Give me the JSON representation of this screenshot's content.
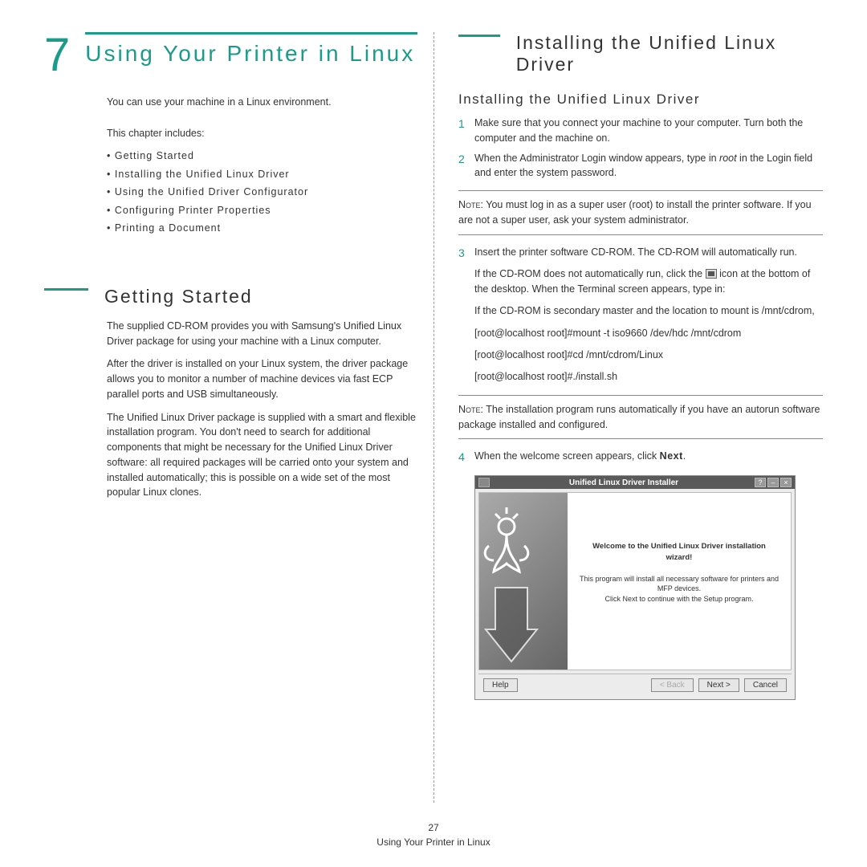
{
  "chapter": {
    "number": "7",
    "title": "Using Your Printer in Linux",
    "intro": "You can use your machine in a Linux environment.",
    "toc_head": "This chapter includes:",
    "toc": [
      "Getting Started",
      "Installing the Unified Linux Driver",
      "Using the Unified Driver Configurator",
      "Configuring Printer Properties",
      "Printing a Document"
    ]
  },
  "getting_started": {
    "title": "Getting Started",
    "p1": "The supplied CD-ROM provides you with Samsung's Unified Linux Driver package for using your machine with a Linux computer.",
    "p2": "After the driver is installed on your Linux system, the driver package allows you to monitor a number of machine devices via fast ECP parallel ports and USB simultaneously.",
    "p3": "The Unified Linux Driver package is supplied with a smart and flexible installation program. You don't need to search for additional components that might be necessary for the Unified Linux Driver software: all required packages will be carried onto your system and installed automatically; this is possible on a wide set of the most popular Linux clones."
  },
  "install": {
    "h1": "Installing the Unified Linux Driver",
    "h2": "Installing the Unified Linux Driver",
    "step1": "Make sure that you connect your machine to your computer. Turn both the computer and the machine on.",
    "step2_a": "When the Administrator Login window appears, type in ",
    "step2_root": "root",
    "step2_b": " in the Login field and enter the system password.",
    "note1_label": "Note",
    "note1": ": You must log in as a super user (root) to install the printer software. If you are not a super user, ask your system administrator.",
    "step3": "Insert the printer software CD-ROM. The CD-ROM will automatically run.",
    "step3_sub1_a": "If the CD-ROM does not automatically run, click the ",
    "step3_sub1_b": " icon at the bottom of the desktop. When the Terminal screen appears, type in:",
    "step3_sub2": "If the CD-ROM is secondary master and the location to mount is /mnt/cdrom,",
    "step3_cmd1": "[root@localhost root]#mount -t iso9660 /dev/hdc /mnt/cdrom",
    "step3_cmd2": "[root@localhost root]#cd /mnt/cdrom/Linux",
    "step3_cmd3": "[root@localhost root]#./install.sh",
    "note2_label": "Note",
    "note2": ": The installation program runs automatically if you have an autorun software package installed and configured.",
    "step4_a": "When the welcome screen appears, click ",
    "step4_b": "Next",
    "step4_c": "."
  },
  "wizard": {
    "title": "Unified Linux Driver Installer",
    "welcome": "Welcome to the Unified Linux Driver installation wizard!",
    "line1": "This program will install all necessary software for printers and MFP devices.",
    "line2": "Click Next to continue with the Setup program.",
    "btn_help": "Help",
    "btn_back": "< Back",
    "btn_next": "Next >",
    "btn_cancel": "Cancel"
  },
  "footer": {
    "page": "27",
    "title": "Using Your Printer in Linux"
  }
}
